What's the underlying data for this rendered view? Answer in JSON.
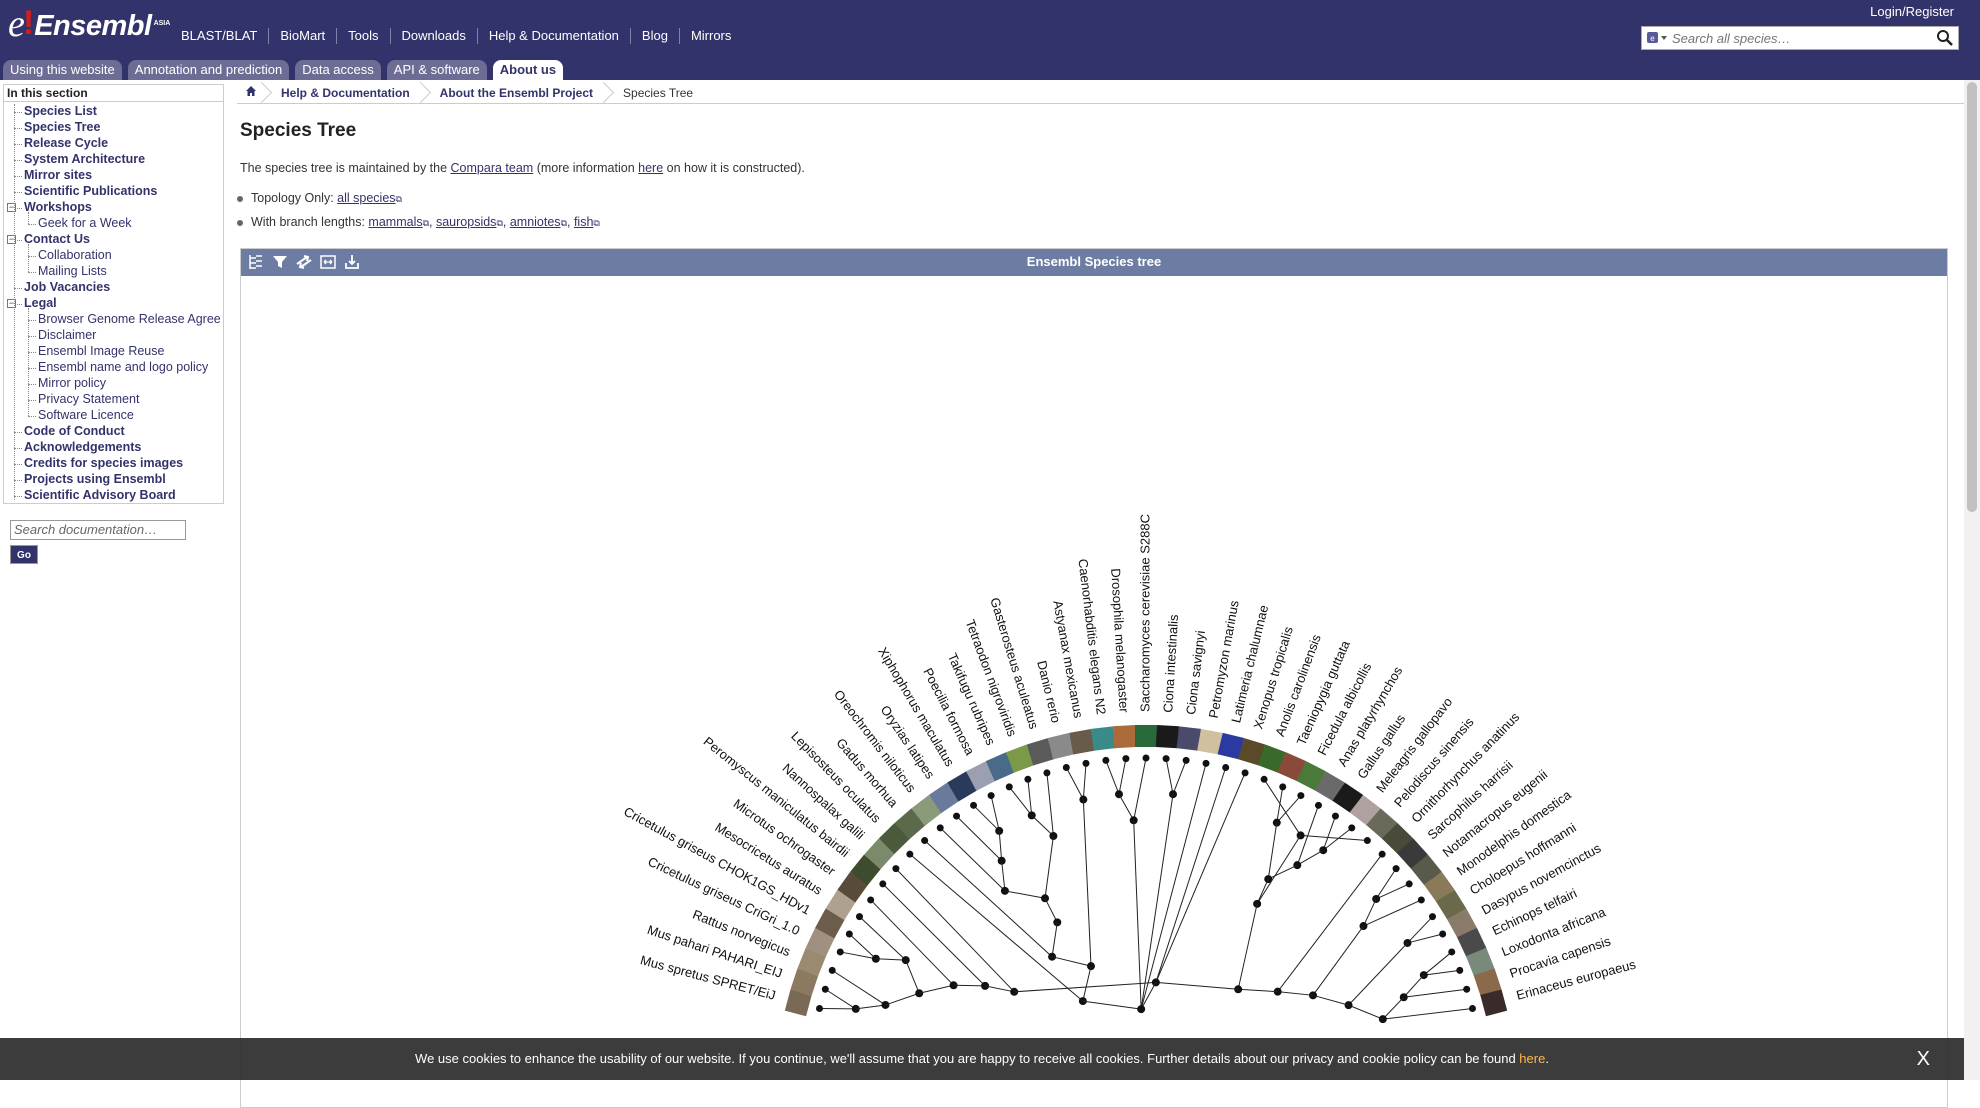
{
  "logo": {
    "brand": "Ensembl",
    "region": "ASIA"
  },
  "toolbar": [
    "BLAST/BLAT",
    "BioMart",
    "Tools",
    "Downloads",
    "Help & Documentation",
    "Blog",
    "Mirrors"
  ],
  "login": "Login/Register",
  "search": {
    "placeholder": "Search all species…"
  },
  "tabs": [
    {
      "label": "Using this website",
      "active": false
    },
    {
      "label": "Annotation and prediction",
      "active": false
    },
    {
      "label": "Data access",
      "active": false
    },
    {
      "label": "API & software",
      "active": false
    },
    {
      "label": "About us",
      "active": true
    }
  ],
  "local_nav": {
    "heading": "In this section",
    "items": [
      {
        "label": "Species List",
        "level": 0
      },
      {
        "label": "Species Tree",
        "level": 0
      },
      {
        "label": "Release Cycle",
        "level": 0
      },
      {
        "label": "System Architecture",
        "level": 0
      },
      {
        "label": "Mirror sites",
        "level": 0
      },
      {
        "label": "Scientific Publications",
        "level": 0
      },
      {
        "label": "Workshops",
        "level": 0,
        "expanded": true
      },
      {
        "label": "Geek for a Week",
        "level": 1
      },
      {
        "label": "Contact Us",
        "level": 0,
        "expanded": true
      },
      {
        "label": "Collaboration",
        "level": 1
      },
      {
        "label": "Mailing Lists",
        "level": 1
      },
      {
        "label": "Job Vacancies",
        "level": 0
      },
      {
        "label": "Legal",
        "level": 0,
        "expanded": true
      },
      {
        "label": "Browser Genome Release Agree",
        "level": 1
      },
      {
        "label": "Disclaimer",
        "level": 1
      },
      {
        "label": "Ensembl Image Reuse",
        "level": 1
      },
      {
        "label": "Ensembl name and logo policy",
        "level": 1
      },
      {
        "label": "Mirror policy",
        "level": 1
      },
      {
        "label": "Privacy Statement",
        "level": 1
      },
      {
        "label": "Software Licence",
        "level": 1
      },
      {
        "label": "Code of Conduct",
        "level": 0
      },
      {
        "label": "Acknowledgements",
        "level": 0
      },
      {
        "label": "Credits for species images",
        "level": 0
      },
      {
        "label": "Projects using Ensembl",
        "level": 0
      },
      {
        "label": "Scientific Advisory Board",
        "level": 0
      }
    ],
    "doc_search_placeholder": "Search documentation…",
    "go_label": "Go"
  },
  "breadcrumb": [
    "Help & Documentation",
    "About the Ensembl Project",
    "Species Tree"
  ],
  "page": {
    "title": "Species Tree",
    "intro_pre": "The species tree is maintained by the ",
    "intro_link1": "Compara team",
    "intro_mid": " (more information ",
    "intro_link2": "here",
    "intro_post": " on how it is constructed).",
    "topology_label": "Topology Only: ",
    "topology_link": "all species",
    "branch_label": "With branch lengths: ",
    "branch_links": [
      "mammals",
      "sauropsids",
      "amniotes",
      "fish"
    ]
  },
  "tree": {
    "title": "Ensembl Species tree",
    "toolbar_icons": [
      "tree-layout-icon",
      "filter-icon",
      "swap-icon",
      "fit-icon",
      "export-icon"
    ],
    "species": [
      "Mus spretus SPRET/EiJ",
      "Mus pahari PAHARI_EIJ",
      "Rattus norvegicus",
      "Cricetulus griseus CriGri_1.0",
      "Cricetulus griseus CHOK1GS_HDv1",
      "Mesocricetus auratus",
      "Microtus ochrogaster",
      "Peromyscus maniculatus bairdii",
      "Nannospalax galili",
      "Lepisosteus oculatus",
      "Gadus morhua",
      "Oreochromis niloticus",
      "Oryzias latipes",
      "Xiphophorus maculatus",
      "Poecilia formosa",
      "Takifugu rubripes",
      "Tetraodon nigroviridis",
      "Gasterosteus aculeatus",
      "Danio rerio",
      "Astyanax mexicanus",
      "Caenorhabditis elegans N2",
      "Drosophila melanogaster",
      "Saccharomyces cerevisiae S288C",
      "Ciona intestinalis",
      "Ciona savignyi",
      "Petromyzon marinus",
      "Latimeria chalumnae",
      "Xenopus tropicalis",
      "Anolis carolinensis",
      "Taeniopygia guttata",
      "Ficedula albicollis",
      "Anas platyrhynchos",
      "Gallus gallus",
      "Meleagris gallopavo",
      "Pelodiscus sinensis",
      "Ornithorhynchus anatinus",
      "Sarcophilus harrisii",
      "Notamacropus eugenii",
      "Monodelphis domestica",
      "Choloepus hoffmanni",
      "Dasypus novemcinctus",
      "Echinops telfairi",
      "Loxodonta africana",
      "Procavia capensis",
      "Erinaceus europaeus"
    ]
  },
  "cookie": {
    "text": "We use cookies to enhance the usability of our website. If you continue, we'll assume that you are happy to receive all cookies. Further details about our privacy and cookie policy can be found ",
    "link": "here",
    "close": "X"
  },
  "colors": {
    "masthead": "#33336b",
    "tabs": "#6c6c94",
    "tree_bar": "#6c7ca3",
    "link": "#33336b"
  }
}
